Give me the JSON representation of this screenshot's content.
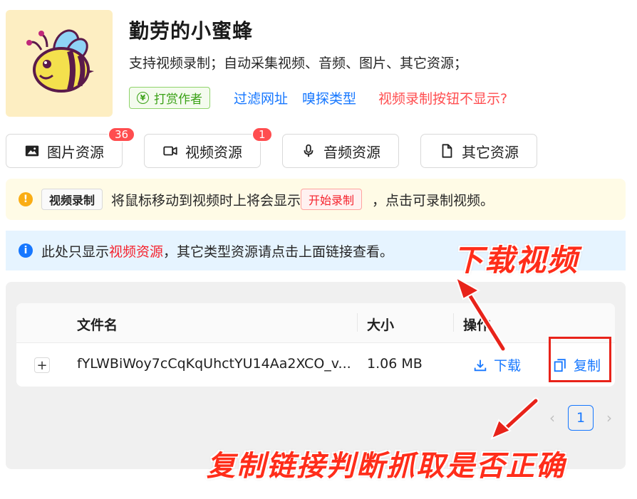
{
  "header": {
    "app_title": "勤劳的小蜜蜂",
    "app_desc": "支持视频录制；自动采集视频、音频、图片、其它资源；",
    "tip_label": "打赏作者",
    "tip_symbol": "¥",
    "links": [
      "过滤网址",
      "嗅探类型",
      "视频录制按钮不显示?"
    ]
  },
  "tabs": [
    {
      "label": "图片资源",
      "icon": "image-icon",
      "badge": "36"
    },
    {
      "label": "视频资源",
      "icon": "video-camera-icon",
      "badge": "1"
    },
    {
      "label": "音频资源",
      "icon": "microphone-icon",
      "badge": ""
    },
    {
      "label": "其它资源",
      "icon": "file-icon",
      "badge": ""
    }
  ],
  "alert_warn": {
    "icon_text": "!",
    "tag": "视频录制",
    "text_before": "将鼠标移动到视频时上将会显示",
    "button_tag": "开始录制",
    "text_after": "，点击可录制视频。"
  },
  "alert_info": {
    "icon_text": "i",
    "text_before": "此处只显示",
    "highlight": "视频资源",
    "text_after": "，其它类型资源请点击上面链接查看。"
  },
  "table": {
    "columns": [
      "文件名",
      "大小",
      "操作"
    ],
    "rows": [
      {
        "expand": "+",
        "filename": "fYLWBiWoy7cCqKqUhctYU14Aa2XCO_v...",
        "size": "1.06 MB",
        "download_label": "下载",
        "copy_label": "复制"
      }
    ]
  },
  "pagination": {
    "prev": "‹",
    "current": "1",
    "next": "›"
  },
  "annotations": {
    "download_video": "下载视频",
    "copy_link_hint": "复制链接判断抓取是否正确"
  },
  "colors": {
    "accent": "#1677ff",
    "danger": "#ff4d4f",
    "success": "#3aa116",
    "annotation_red": "#ff2d1a"
  }
}
